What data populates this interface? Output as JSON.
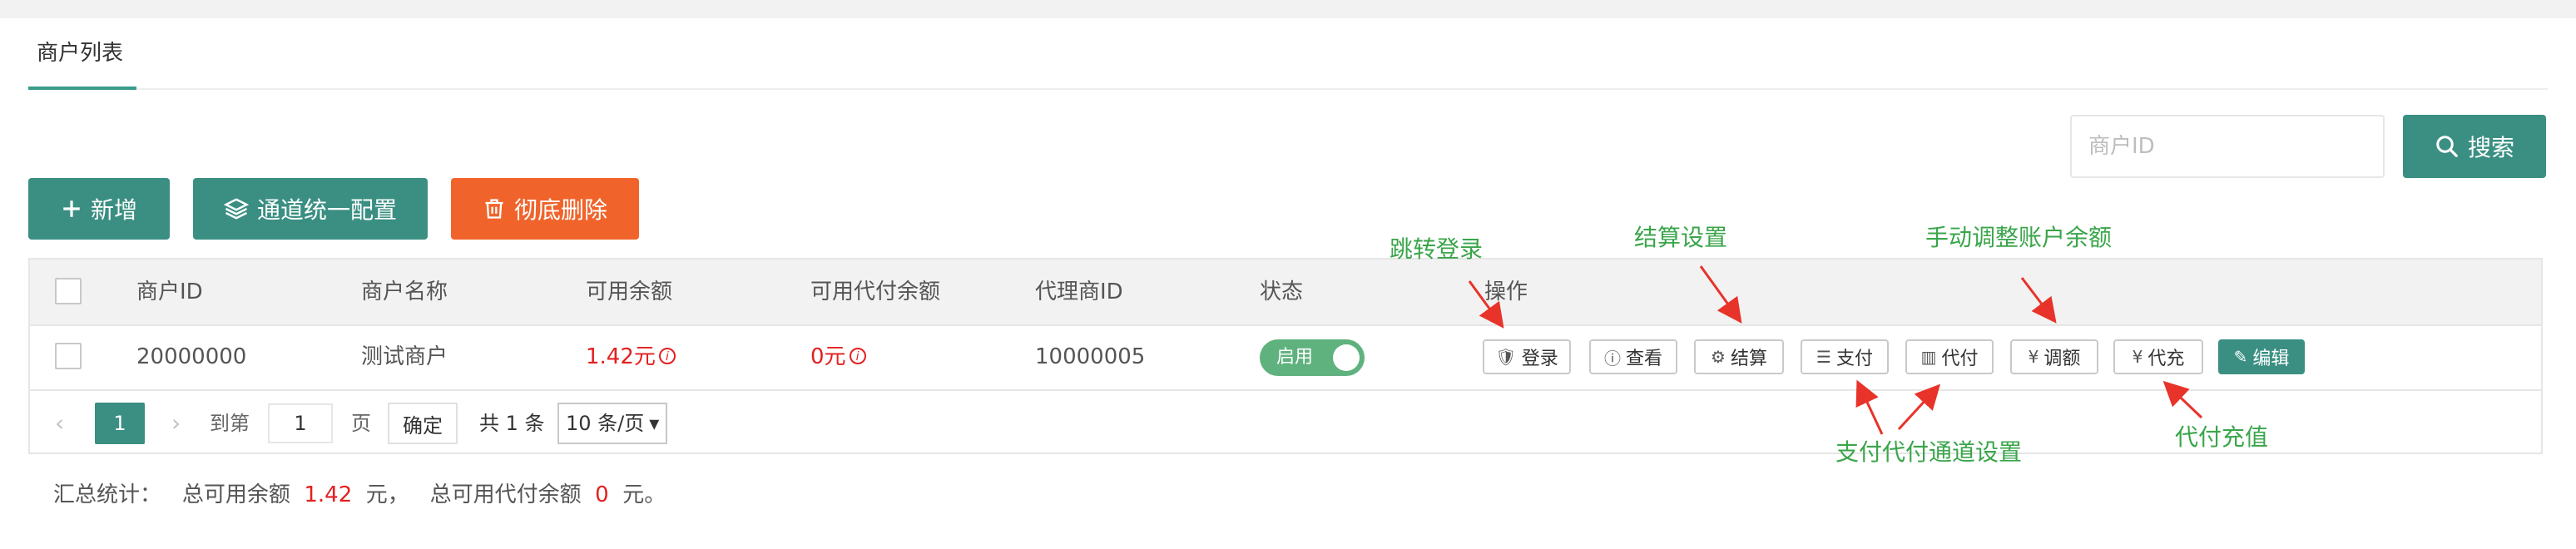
{
  "tab": {
    "label": "商户列表"
  },
  "search": {
    "placeholder": "商户ID",
    "button_label": "搜索"
  },
  "toolbar": {
    "add_label": "新增",
    "channel_config_label": "通道统一配置",
    "delete_label": "彻底删除"
  },
  "table": {
    "headers": {
      "merchant_id": "商户ID",
      "merchant_name": "商户名称",
      "balance": "可用余额",
      "payout_balance": "可用代付余额",
      "agent_id": "代理商ID",
      "status": "状态",
      "actions": "操作"
    },
    "rows": [
      {
        "merchant_id": "20000000",
        "merchant_name": "测试商户",
        "balance": "1.42元",
        "payout_balance": "0元",
        "agent_id": "10000005",
        "status": "启用",
        "actions": {
          "login": "登录",
          "view": "查看",
          "settle": "结算",
          "pay": "支付",
          "payout": "代付",
          "adjust": "调额",
          "recharge": "代充",
          "edit": "编辑"
        }
      }
    ]
  },
  "pagination": {
    "prev": "‹",
    "current_page": "1",
    "next": "›",
    "goto_label": "到第",
    "goto_value": "1",
    "page_unit": "页",
    "confirm_label": "确定",
    "total_text": "共 1 条",
    "page_size": "10 条/页"
  },
  "summary": {
    "label": "汇总统计：",
    "balance_prefix": "总可用余额",
    "balance_value": "1.42",
    "balance_suffix": "元，",
    "payout_prefix": "总可用代付余额",
    "payout_value": "0",
    "payout_suffix": "元。"
  },
  "annotations": {
    "jump_login": "跳转登录",
    "settle_settings": "结算设置",
    "manual_adjust": "手动调整账户余额",
    "channel_settings": "支付代付通道设置",
    "payout_recharge": "代付充值"
  },
  "colors": {
    "primary": "#3a8f82",
    "danger": "#f0642b",
    "amount_red": "#e41f1f",
    "status_green": "#5fb27e",
    "annotation_green": "#3aa54a",
    "arrow_red": "#e8332a"
  },
  "icons": {
    "add": "plus-icon",
    "channel": "layers-icon",
    "delete": "trash-icon",
    "search": "search-icon",
    "login": "shield-check-icon",
    "view": "info-icon",
    "settle": "gear-icon",
    "pay": "layers-icon",
    "payout": "book-icon",
    "adjust": "yen-icon",
    "recharge": "yen-icon",
    "edit": "pencil-icon"
  }
}
